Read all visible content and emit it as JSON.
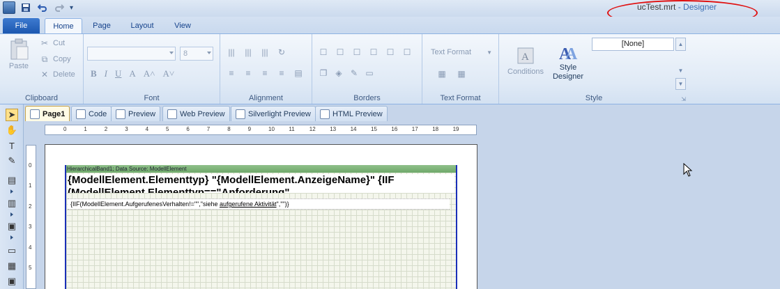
{
  "title_bar": {
    "document": "ucTest.mrt",
    "separator": "-",
    "app_name": "Designer",
    "qat_more": "▾"
  },
  "ribbon_tabs": [
    {
      "label": "File"
    },
    {
      "label": "Home"
    },
    {
      "label": "Page"
    },
    {
      "label": "Layout"
    },
    {
      "label": "View"
    }
  ],
  "clipboard": {
    "paste": "Paste",
    "cut": "Cut",
    "copy": "Copy",
    "delete": "Delete",
    "group": "Clipboard"
  },
  "font": {
    "font_name": "",
    "font_size": "8",
    "bold": "B",
    "italic": "I",
    "underline": "U",
    "color": "A",
    "grow": "A˄",
    "shrink": "A˅",
    "group": "Font"
  },
  "alignment": {
    "group": "Alignment"
  },
  "borders": {
    "group": "Borders"
  },
  "text_format": {
    "label": "Text Format",
    "group": "Text Format"
  },
  "style": {
    "conditions": "Conditions",
    "style_designer": "Style Designer",
    "style_value": "[None]",
    "group": "Style"
  },
  "doc_tabs": [
    {
      "label": "Page1"
    },
    {
      "label": "Code"
    },
    {
      "label": "Preview"
    },
    {
      "label": "Web Preview"
    },
    {
      "label": "Silverlight Preview"
    },
    {
      "label": "HTML Preview"
    }
  ],
  "ruler_h": [
    "0",
    "1",
    "2",
    "3",
    "4",
    "5",
    "6",
    "7",
    "8",
    "9",
    "10",
    "11",
    "12",
    "13",
    "14",
    "15",
    "16",
    "17",
    "18",
    "19"
  ],
  "ruler_v": [
    "0",
    "1",
    "2",
    "3",
    "4",
    "5"
  ],
  "band": {
    "header": "HierarchicalBand1; Data Source: ModellElement",
    "big_text_line1": "{ModellElement.Elementtyp} \"{ModellElement.AnzeigeName}\" {IIF",
    "big_text_line2": "(ModellElement.Elementtyp==\"Anforderung\"",
    "small_text_pre": "{IIF(ModellElement.AufgerufenesVerhalten!=\"\",\"siehe ",
    "small_text_link": "aufgerufene Aktivität",
    "small_text_post": "\",\"\")}"
  }
}
